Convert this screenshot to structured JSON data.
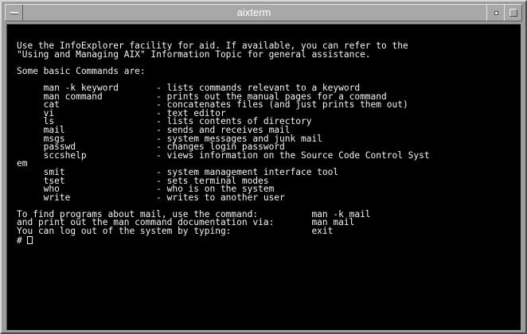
{
  "window": {
    "title": "aixterm"
  },
  "terminal": {
    "output": "Use the InfoExplorer facility for aid. If available, you can refer to the\n\"Using and Managing AIX\" Information Topic for general assistance.\n\nSome basic Commands are:\n\n     man -k keyword       - lists commands relevant to a keyword\n     man command          - prints out the manual pages for a command\n     cat                  - concatenates files (and just prints them out)\n     vi                   - text editor\n     ls                   - lists contents of directory\n     mail                 - sends and receives mail\n     msgs                 - system messages and junk mail\n     passwd               - changes login password\n     sccshelp             - views information on the Source Code Control Syst\nem\n     smit                 - system management interface tool\n     tset                 - sets terminal modes\n     who                  - who is on the system\n     write                - writes to another user\n\nTo find programs about mail, use the command:          man -k mail\nand print out the man command documentation via:       man mail\nYou can log out of the system by typing:               exit\n",
    "prompt": "# "
  }
}
